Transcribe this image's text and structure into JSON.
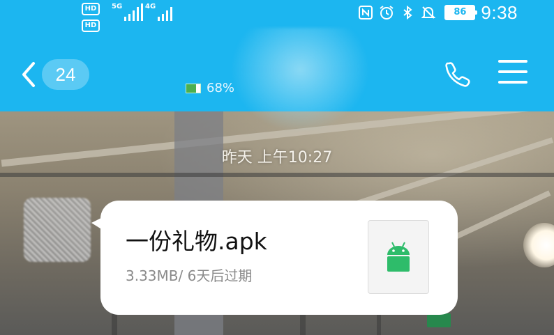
{
  "status_bar": {
    "sim1_badge": "HD",
    "sim2_badge": "HD",
    "sim1_network": "5G",
    "sim2_network": "4G",
    "battery_level": "86",
    "time": "9:38",
    "icons": [
      "nfc-icon",
      "alarm-icon",
      "bluetooth-icon",
      "mute-bell-icon"
    ]
  },
  "header": {
    "unread_count": "24",
    "peer_battery_text": "68%",
    "actions": [
      "phone-icon",
      "menu-icon"
    ]
  },
  "chat": {
    "timestamp": "昨天 上午10:27",
    "message": {
      "file_name": "一份礼物.apk",
      "file_meta": "3.33MB/ 6天后过期",
      "file_type_icon": "android-icon"
    }
  },
  "colors": {
    "header_bg": "#1cb6f0",
    "bubble_bg": "#ffffff",
    "android_green": "#2ebc6a"
  }
}
